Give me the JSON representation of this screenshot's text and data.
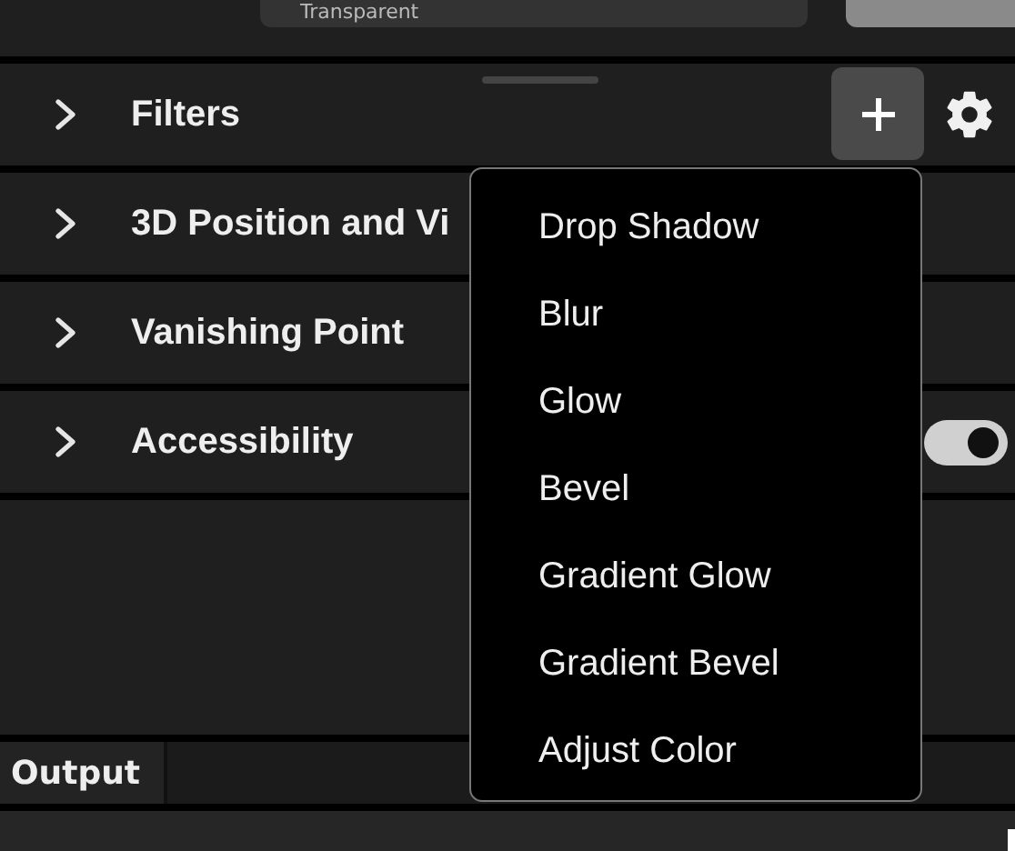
{
  "top": {
    "field_value": "Transparent"
  },
  "sections": [
    {
      "label": "Filters",
      "expanded": false,
      "kind": "actions"
    },
    {
      "label": "3D Position and Vi",
      "expanded": false,
      "kind": "plain"
    },
    {
      "label": "Vanishing Point",
      "expanded": false,
      "kind": "plain"
    },
    {
      "label": "Accessibility",
      "expanded": false,
      "kind": "toggle",
      "on": true
    }
  ],
  "menu": {
    "items": [
      "Drop Shadow",
      "Blur",
      "Glow",
      "Bevel",
      "Gradient Glow",
      "Gradient Bevel",
      "Adjust Color"
    ]
  },
  "bottom_tabs": [
    {
      "label": "Output",
      "selected": true
    }
  ]
}
